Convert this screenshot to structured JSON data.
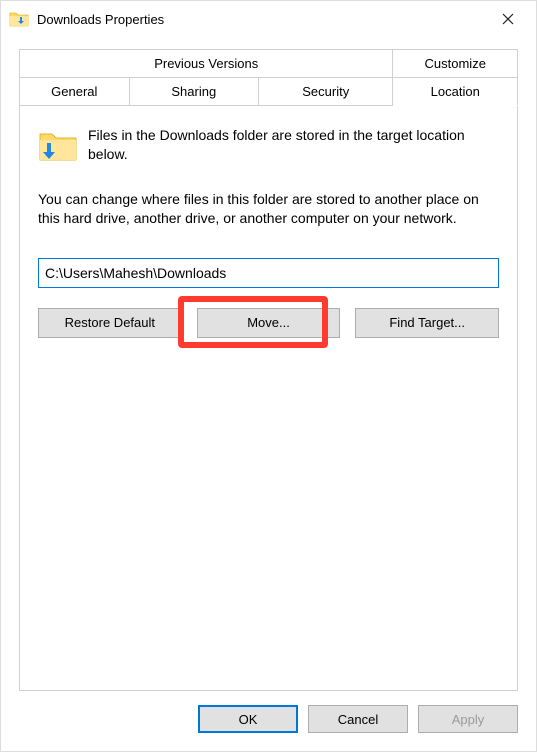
{
  "titleIcon": "downloads-folder-icon",
  "title": "Downloads Properties",
  "tabs": {
    "row1": [
      "Previous Versions",
      "Customize"
    ],
    "row2": [
      "General",
      "Sharing",
      "Security",
      "Location"
    ],
    "active": "Location"
  },
  "content": {
    "intro": "Files in the Downloads folder are stored in the target location below.",
    "desc": "You can change where files in this folder are stored to another place on this hard drive, another drive, or another computer on your network.",
    "path": "C:\\Users\\Mahesh\\Downloads",
    "buttons": {
      "restore": "Restore Default",
      "move": "Move...",
      "find": "Find Target..."
    }
  },
  "bottom": {
    "ok": "OK",
    "cancel": "Cancel",
    "apply": "Apply"
  }
}
